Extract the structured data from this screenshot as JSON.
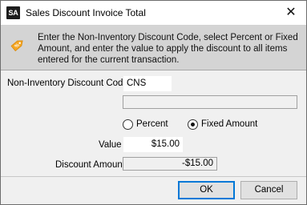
{
  "window": {
    "icon_text": "SA",
    "title": "Sales Discount Invoice Total",
    "close_glyph": "✕"
  },
  "info": {
    "text": "Enter the Non-Inventory Discount Code, select Percent or Fixed Amount, and enter the value to apply the discount to all items entered for the current transaction."
  },
  "form": {
    "code_label": "Non-Inventory Discount Code",
    "code_value": "CNS",
    "description_value": "",
    "percent_label": "Percent",
    "fixed_label": "Fixed Amount",
    "selected_mode": "Fixed Amount",
    "value_label": "Value",
    "value": "$15.00",
    "discount_label": "Discount Amount",
    "discount_value": "-$15.00"
  },
  "buttons": {
    "ok": "OK",
    "cancel": "Cancel"
  },
  "colors": {
    "info_panel": "#d4d4d4",
    "tag_icon": "#f5a623",
    "default_button_border": "#0078d7"
  }
}
